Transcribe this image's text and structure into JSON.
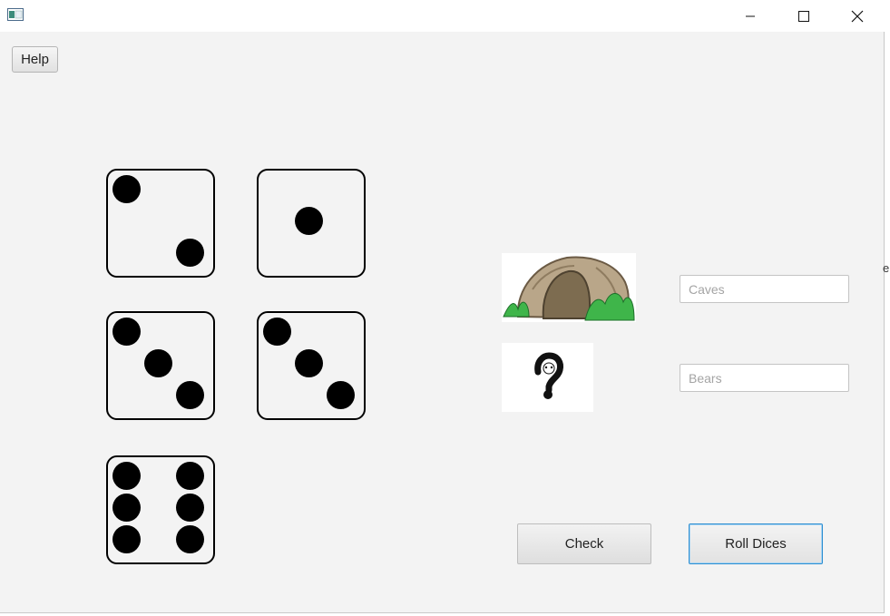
{
  "window": {
    "icon": "app-window-icon",
    "controls": [
      "minimize-icon",
      "maximize-icon",
      "close-icon"
    ]
  },
  "toolbar": {
    "help_label": "Help"
  },
  "dice": [
    {
      "value": 2
    },
    {
      "value": 1
    },
    {
      "value": 3
    },
    {
      "value": 3
    },
    {
      "value": 6
    }
  ],
  "images": {
    "cave": "cave-image",
    "bear": "question-mark-bear-image"
  },
  "inputs": {
    "caves": {
      "value": "",
      "placeholder": "Caves"
    },
    "bears": {
      "value": "",
      "placeholder": "Bears"
    }
  },
  "buttons": {
    "check_label": "Check",
    "roll_label": "Roll Dices"
  },
  "edge_text": {
    "e": "e"
  },
  "colors": {
    "focus_border": "#2f8fd1",
    "background": "#f3f3f3"
  }
}
